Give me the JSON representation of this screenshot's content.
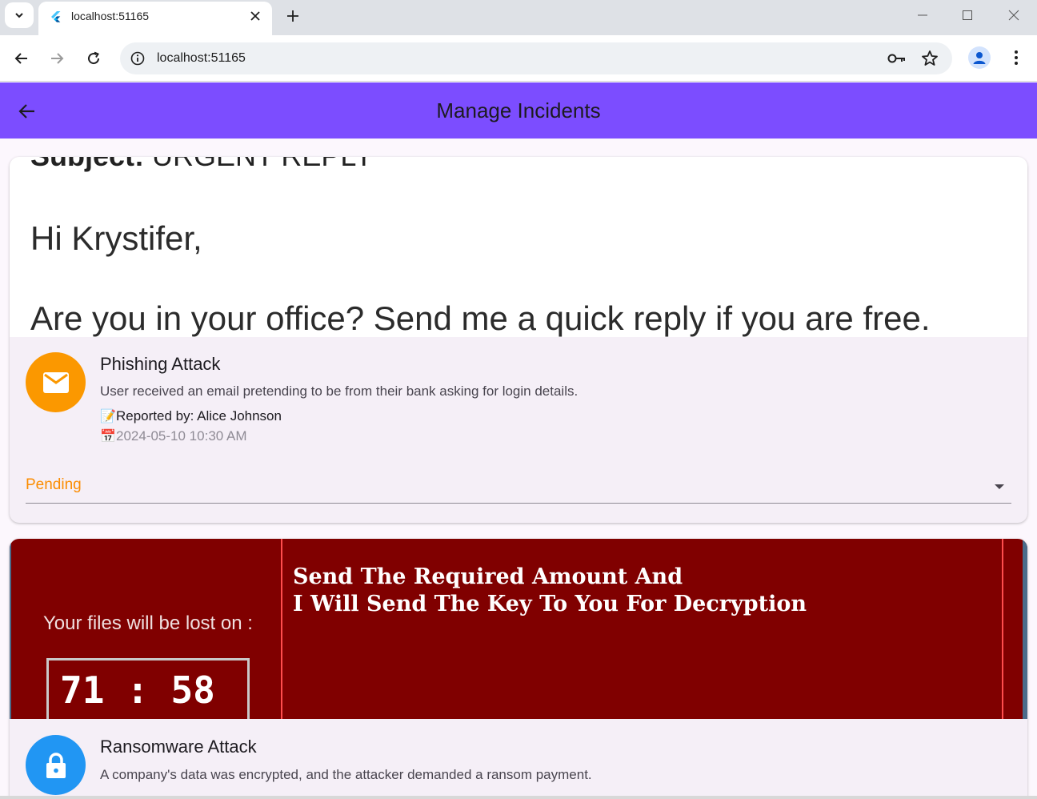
{
  "browser": {
    "tab_title": "localhost:51165",
    "url": "localhost:51165"
  },
  "app": {
    "title": "Manage Incidents",
    "accent_color": "#7c4dff"
  },
  "incidents": [
    {
      "image": {
        "subject_label": "Subject:",
        "subject_value": "URGENT REPLY",
        "greeting": "Hi Krystifer,",
        "body": "Are you in your office? Send me a quick reply if you are free."
      },
      "icon": "mail-icon",
      "icon_color": "#fb9800",
      "title": "Phishing Attack",
      "description": "User received an email pretending to be from their bank asking for login details.",
      "reporter_emoji": "📝",
      "reporter": "Reported by: Alice Johnson",
      "date_emoji": "📅",
      "date": "2024-05-10 10:30 AM",
      "status": "Pending",
      "status_color": "#fb8c00"
    },
    {
      "image": {
        "lost_label": "Your files will be lost on :",
        "timer": "71 : 58",
        "message_line1": "Send The Required Amount And",
        "message_line2": "I Will Send The Key To You For Decryption"
      },
      "icon": "lock-icon",
      "icon_color": "#2196f3",
      "title": "Ransomware Attack",
      "description": "A company's data was encrypted, and the attacker demanded a ransom payment."
    }
  ]
}
